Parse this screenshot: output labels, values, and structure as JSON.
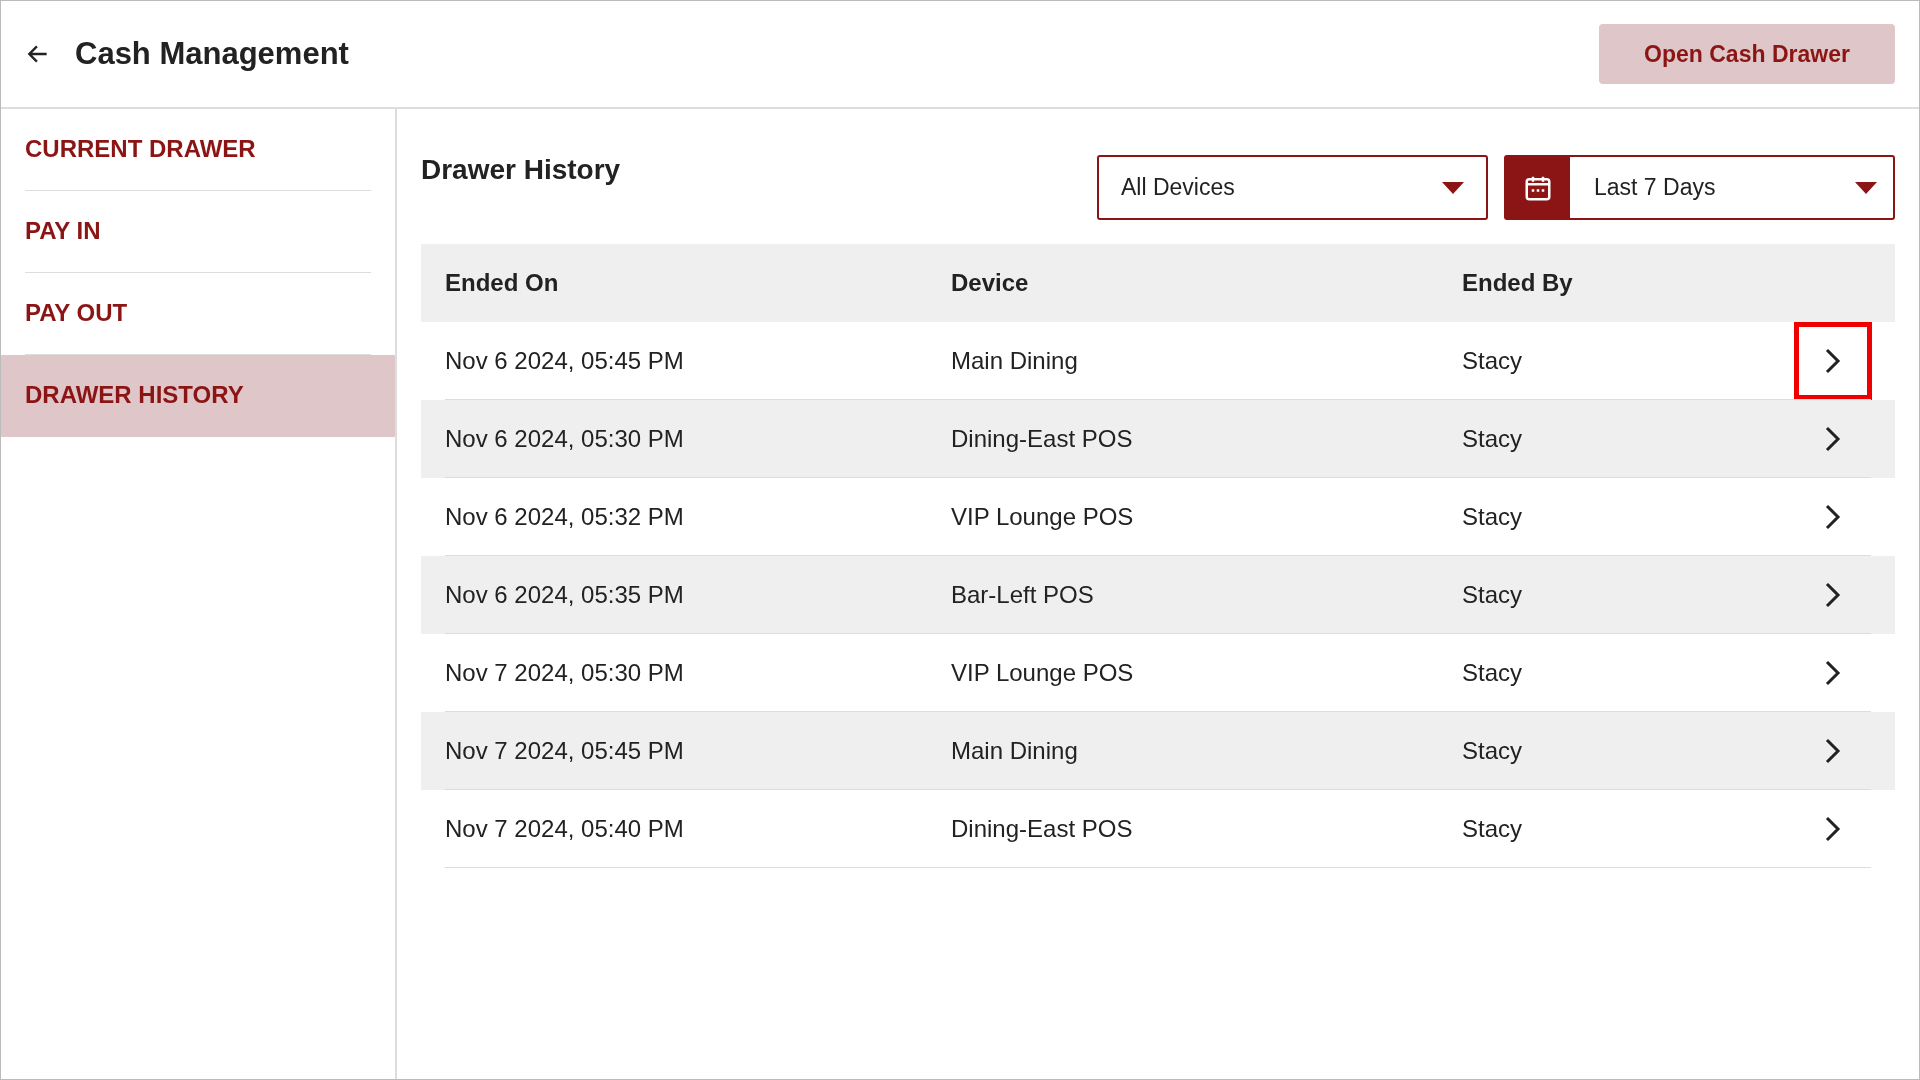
{
  "header": {
    "title": "Cash Management",
    "action_button": "Open Cash Drawer"
  },
  "sidebar": {
    "items": [
      {
        "label": "CURRENT DRAWER",
        "selected": false
      },
      {
        "label": "PAY IN",
        "selected": false
      },
      {
        "label": "PAY OUT",
        "selected": false
      },
      {
        "label": "DRAWER HISTORY",
        "selected": true
      }
    ]
  },
  "content": {
    "title": "Drawer History",
    "device_filter": {
      "value": "All Devices"
    },
    "date_filter": {
      "value": "Last 7 Days"
    },
    "table": {
      "columns": [
        "Ended On",
        "Device",
        "Ended By"
      ],
      "rows": [
        {
          "cells": [
            "Nov 6 2024, 05:45 PM",
            "Main Dining",
            "Stacy"
          ],
          "highlighted": true
        },
        {
          "cells": [
            "Nov 6 2024, 05:30 PM",
            "Dining-East POS",
            "Stacy"
          ],
          "highlighted": false
        },
        {
          "cells": [
            "Nov 6 2024, 05:32 PM",
            "VIP Lounge POS",
            "Stacy"
          ],
          "highlighted": false
        },
        {
          "cells": [
            "Nov 6 2024, 05:35 PM",
            "Bar-Left POS",
            "Stacy"
          ],
          "highlighted": false
        },
        {
          "cells": [
            "Nov 7 2024, 05:30 PM",
            "VIP Lounge POS",
            "Stacy"
          ],
          "highlighted": false
        },
        {
          "cells": [
            "Nov 7 2024, 05:45 PM",
            "Main Dining",
            "Stacy"
          ],
          "highlighted": false
        },
        {
          "cells": [
            "Nov 7 2024, 05:40 PM",
            "Dining-East POS",
            "Stacy"
          ],
          "highlighted": false
        }
      ]
    }
  }
}
